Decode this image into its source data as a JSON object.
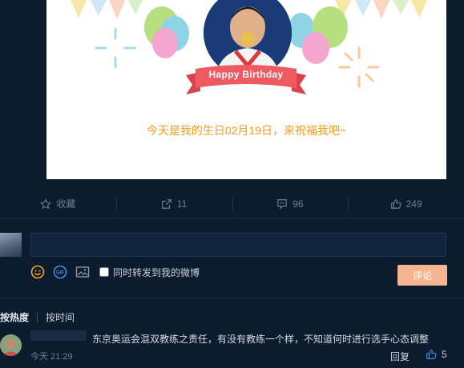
{
  "card": {
    "ribbon_text": "Happy Birthday",
    "wish_text": "今天是我的生日02月19日，来祝福我吧~"
  },
  "actions": [
    {
      "icon": "star-icon",
      "label": "收藏"
    },
    {
      "icon": "share-icon",
      "label": "11"
    },
    {
      "icon": "comment-icon",
      "label": "96"
    },
    {
      "icon": "like-icon",
      "label": "249"
    }
  ],
  "composer": {
    "input_value": "",
    "repost_label": "同时转发到我的微博",
    "repost_checked": false,
    "submit_label": "评论",
    "tools": [
      "emoji-icon",
      "gif-icon",
      "image-icon"
    ]
  },
  "sort": {
    "tabs": [
      "按热度",
      "按时间"
    ],
    "active": "按热度"
  },
  "comment": {
    "text": "东京奥运会混双教练之责任，有没有教练一个样，不知道何时进行选手心态调整",
    "time": "今天 21:29",
    "reply_label": "回复",
    "like_count": "5"
  },
  "colors": {
    "background": "#0d1b2f",
    "wish_orange": "#f39c1f",
    "ribbon_red": "#ee5a61",
    "submit_peach": "#f6b592"
  }
}
